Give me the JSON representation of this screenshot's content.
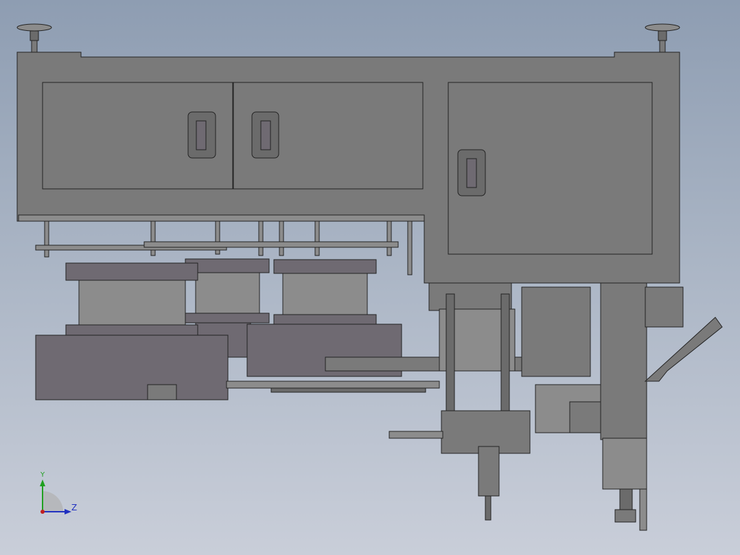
{
  "triad": {
    "y_label": "Y",
    "z_label": "Z"
  },
  "colors": {
    "body": "#7a7a7a",
    "outline": "#222222",
    "background_top": "#8e9db2",
    "background_bottom": "#c9ced9",
    "axis_y": "#20a020",
    "axis_z": "#2030c0",
    "origin": "#c02020"
  }
}
